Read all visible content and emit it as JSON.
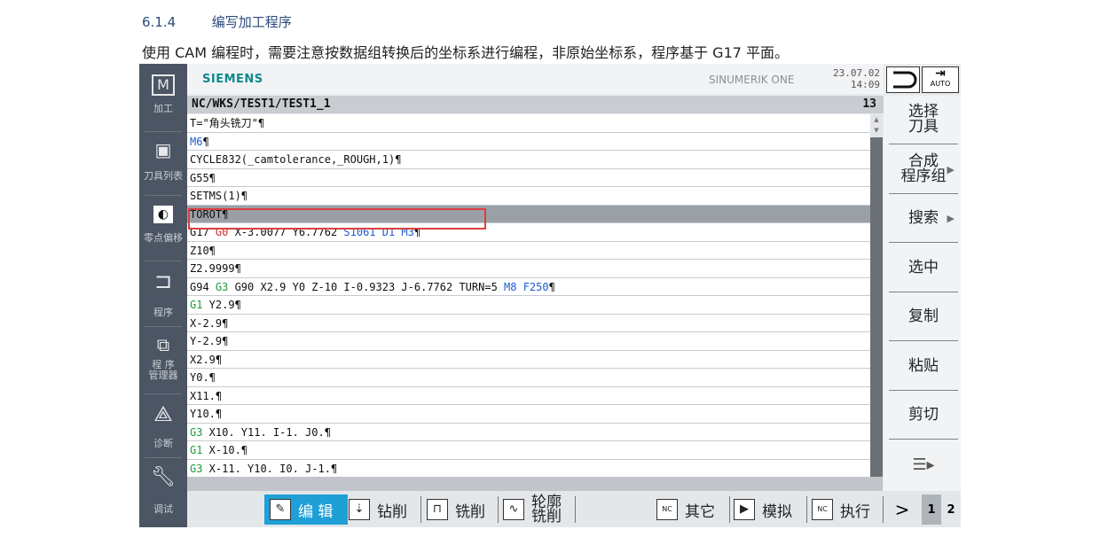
{
  "doc": {
    "section_number": "6.1.4",
    "section_title": "编写加工程序",
    "description": "使用 CAM 编程时，需要注意按数据组转换后的坐标系进行编程，非原始坐标系，程序基于 G17 平面。"
  },
  "header": {
    "brand": "SIEMENS",
    "product": "SINUMERIK ONE",
    "date": "23.07.02",
    "time": "14:09",
    "auto_label": "AUTO"
  },
  "left_nav": [
    {
      "label": "加工",
      "icon": "machine-icon"
    },
    {
      "label": "刀具列表",
      "icon": "tool-list-icon"
    },
    {
      "label": "零点偏移",
      "icon": "zero-offset-icon"
    },
    {
      "label": "程序",
      "icon": "program-icon"
    },
    {
      "label": "程 序\n管理器",
      "icon": "program-manager-icon"
    },
    {
      "label": "诊断",
      "icon": "diagnostics-icon"
    },
    {
      "label": "调试",
      "icon": "commissioning-icon"
    }
  ],
  "editor": {
    "path": "NC/WKS/TEST1/TEST1_1",
    "line_count": "13",
    "lines": [
      "T=\"角头铣刀\"¶",
      "M6¶",
      "CYCLE832(_camtolerance,_ROUGH,1)¶",
      "G55¶",
      "SETMS(1)¶",
      "TOROT¶",
      "G17 G0 X-3.0077 Y6.7762 S1061 D1 M3¶",
      "Z10¶",
      "Z2.9999¶",
      "G94 G3 G90 X2.9 Y0 Z-10 I-0.9323 J-6.7762 TURN=5 M8 F250¶",
      "G1 Y2.9¶",
      "X-2.9¶",
      "Y-2.9¶",
      "X2.9¶",
      "Y0.¶",
      "X11.¶",
      "Y10.¶",
      "G3 X10. Y11. I-1. J0.¶",
      "G1 X-10.¶",
      "G3 X-11. Y10. I0. J-1.¶"
    ],
    "selected_line": 5
  },
  "right_softkeys": [
    {
      "label": "选择\n刀具",
      "arrow": false
    },
    {
      "label": "合成\n程序组",
      "arrow": true
    },
    {
      "label": "搜索",
      "arrow": true
    },
    {
      "label": "选中",
      "arrow": false
    },
    {
      "label": "复制",
      "arrow": false
    },
    {
      "label": "粘贴",
      "arrow": false
    },
    {
      "label": "剪切",
      "arrow": false
    },
    {
      "label": "",
      "arrow": true
    }
  ],
  "bottom_softkeys": [
    {
      "label": "编 辑",
      "icon": "edit-icon",
      "active": true
    },
    {
      "label": "钻削",
      "icon": "drilling-icon",
      "active": false
    },
    {
      "label": "铣削",
      "icon": "milling-icon",
      "active": false
    },
    {
      "label": "轮廓\n铣削",
      "icon": "contour-milling-icon",
      "active": false
    },
    {
      "label": "其它",
      "icon": "nc-other-icon",
      "active": false
    },
    {
      "label": "模拟",
      "icon": "simulation-icon",
      "active": false
    },
    {
      "label": "执行",
      "icon": "nc-execute-icon",
      "active": false
    }
  ],
  "pager": {
    "next": ">",
    "page1": "1",
    "page2": "2"
  }
}
